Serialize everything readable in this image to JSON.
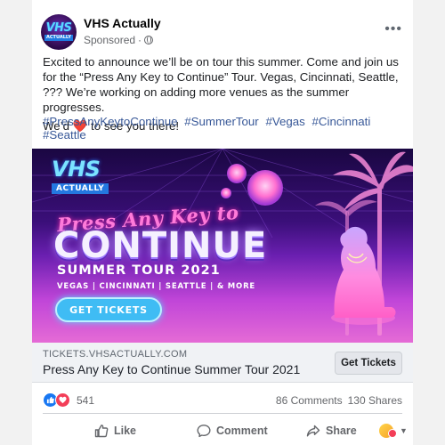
{
  "post": {
    "page_name": "VHS Actually",
    "sponsored_label": "Sponsored",
    "more_icon": "more-horizontal-icon",
    "avatar": {
      "line1": "VHS",
      "line2": "ACTUALLY"
    },
    "body_paragraph_1": "Excited to announce we’ll be on tour this summer.  Come and join us for the “Press Any Key to Continue” Tour. Vegas, Cincinnati, Seattle, ??? We’re working on adding more venues as the summer progresses.",
    "body_paragraph_2_prefix": "We’d",
    "body_paragraph_2_emoji": "❤️",
    "body_paragraph_2_suffix": "to see you there!",
    "hashtags": [
      "#PressAnyKeytoContinue",
      "#SummerTour",
      "#Vegas",
      "#Cincinnati",
      "#Seattle"
    ]
  },
  "banner": {
    "logo_line1": "VHS",
    "logo_line2": "ACTUALLY",
    "title_script": "Press Any Key to",
    "title_main": "CONTINUE",
    "tour_line": "SUMMER TOUR 2021",
    "cities_line": "VEGAS | CINCINNATI | SEATTLE | & MORE",
    "button_label": "GET TICKETS"
  },
  "link": {
    "domain": "TICKETS.VHSACTUALLY.COM",
    "title": "Press Any Key to Continue Summer Tour 2021",
    "button_label": "Get Tickets"
  },
  "stats": {
    "reaction_count": "541",
    "comments": "86 Comments",
    "shares": "130 Shares"
  },
  "actions": {
    "like": "Like",
    "comment": "Comment",
    "share": "Share"
  },
  "colors": {
    "link_blue": "#385898",
    "like_blue": "#1877f2",
    "love_red": "#f33e58",
    "banner_purple": "#3b0f7a",
    "banner_pink": "#e56bd6",
    "ticket_cyan": "#3fbcf4"
  }
}
